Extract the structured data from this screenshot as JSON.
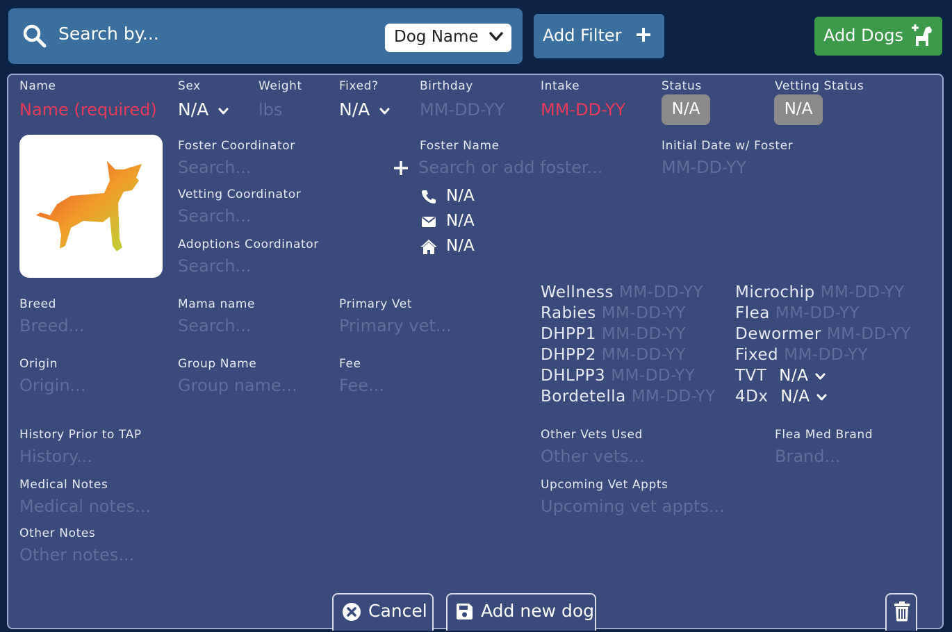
{
  "topbar": {
    "search_placeholder": "Search by...",
    "search_field": "Dog Name",
    "add_filter": "Add Filter",
    "add_dogs": "Add Dogs"
  },
  "form": {
    "name": {
      "label": "Name",
      "placeholder": "Name (required)"
    },
    "sex": {
      "label": "Sex",
      "value": "N/A"
    },
    "weight": {
      "label": "Weight",
      "placeholder": "lbs"
    },
    "fixed": {
      "label": "Fixed?",
      "value": "N/A"
    },
    "birthday": {
      "label": "Birthday",
      "placeholder": "MM-DD-YY"
    },
    "intake": {
      "label": "Intake",
      "placeholder": "MM-DD-YY"
    },
    "status": {
      "label": "Status",
      "value": "N/A"
    },
    "vetting_status": {
      "label": "Vetting Status",
      "value": "N/A"
    },
    "foster_coordinator": {
      "label": "Foster Coordinator",
      "placeholder": "Search..."
    },
    "vetting_coordinator": {
      "label": "Vetting Coordinator",
      "placeholder": "Search..."
    },
    "adoptions_coordinator": {
      "label": "Adoptions Coordinator",
      "placeholder": "Search..."
    },
    "foster_name": {
      "label": "Foster Name",
      "placeholder": "Search or add foster..."
    },
    "foster_phone": "N/A",
    "foster_email": "N/A",
    "foster_address": "N/A",
    "initial_date": {
      "label": "Initial Date w/ Foster",
      "placeholder": "MM-DD-YY"
    },
    "breed": {
      "label": "Breed",
      "placeholder": "Breed..."
    },
    "mama_name": {
      "label": "Mama name",
      "placeholder": "Search..."
    },
    "primary_vet": {
      "label": "Primary Vet",
      "placeholder": "Primary vet..."
    },
    "origin": {
      "label": "Origin",
      "placeholder": "Origin..."
    },
    "group_name": {
      "label": "Group Name",
      "placeholder": "Group name..."
    },
    "fee": {
      "label": "Fee",
      "placeholder": "Fee..."
    },
    "history": {
      "label": "History Prior to TAP",
      "placeholder": "History..."
    },
    "medical_notes": {
      "label": "Medical Notes",
      "placeholder": "Medical notes..."
    },
    "other_notes": {
      "label": "Other Notes",
      "placeholder": "Other notes..."
    },
    "other_vets": {
      "label": "Other Vets Used",
      "placeholder": "Other vets..."
    },
    "flea_brand": {
      "label": "Flea Med Brand",
      "placeholder": "Brand..."
    },
    "upcoming_appts": {
      "label": "Upcoming Vet Appts",
      "placeholder": "Upcoming vet appts..."
    }
  },
  "vetting_left": [
    {
      "label": "Wellness",
      "date": "MM-DD-YY"
    },
    {
      "label": "Rabies",
      "date": "MM-DD-YY"
    },
    {
      "label": "DHPP1",
      "date": "MM-DD-YY"
    },
    {
      "label": "DHPP2",
      "date": "MM-DD-YY"
    },
    {
      "label": "DHLPP3",
      "date": "MM-DD-YY"
    },
    {
      "label": "Bordetella",
      "date": "MM-DD-YY"
    }
  ],
  "vetting_right": [
    {
      "label": "Microchip",
      "date": "MM-DD-YY"
    },
    {
      "label": "Flea",
      "date": "MM-DD-YY"
    },
    {
      "label": "Dewormer",
      "date": "MM-DD-YY"
    },
    {
      "label": "Fixed",
      "date": "MM-DD-YY"
    }
  ],
  "vetting_selects": [
    {
      "label": "TVT",
      "value": "N/A"
    },
    {
      "label": "4Dx",
      "value": "N/A"
    }
  ],
  "actions": {
    "cancel": "Cancel",
    "add_new_dog": "Add new dog"
  },
  "colors": {
    "background": "#0c2346",
    "card": "#3a4a7a",
    "accent_blue": "#3b6f9e",
    "success_green": "#3c9a4a",
    "required_red": "#e83a5a",
    "badge_gray": "#8a8a8a"
  },
  "icons": {
    "search": "search-icon",
    "chevron": "chevron-down-icon",
    "plus": "plus-icon",
    "dog_add": "dog-plus-icon",
    "phone": "phone-icon",
    "email": "envelope-icon",
    "home": "home-icon",
    "cancel": "close-circle-icon",
    "save": "floppy-disk-icon",
    "trash": "trash-icon"
  }
}
